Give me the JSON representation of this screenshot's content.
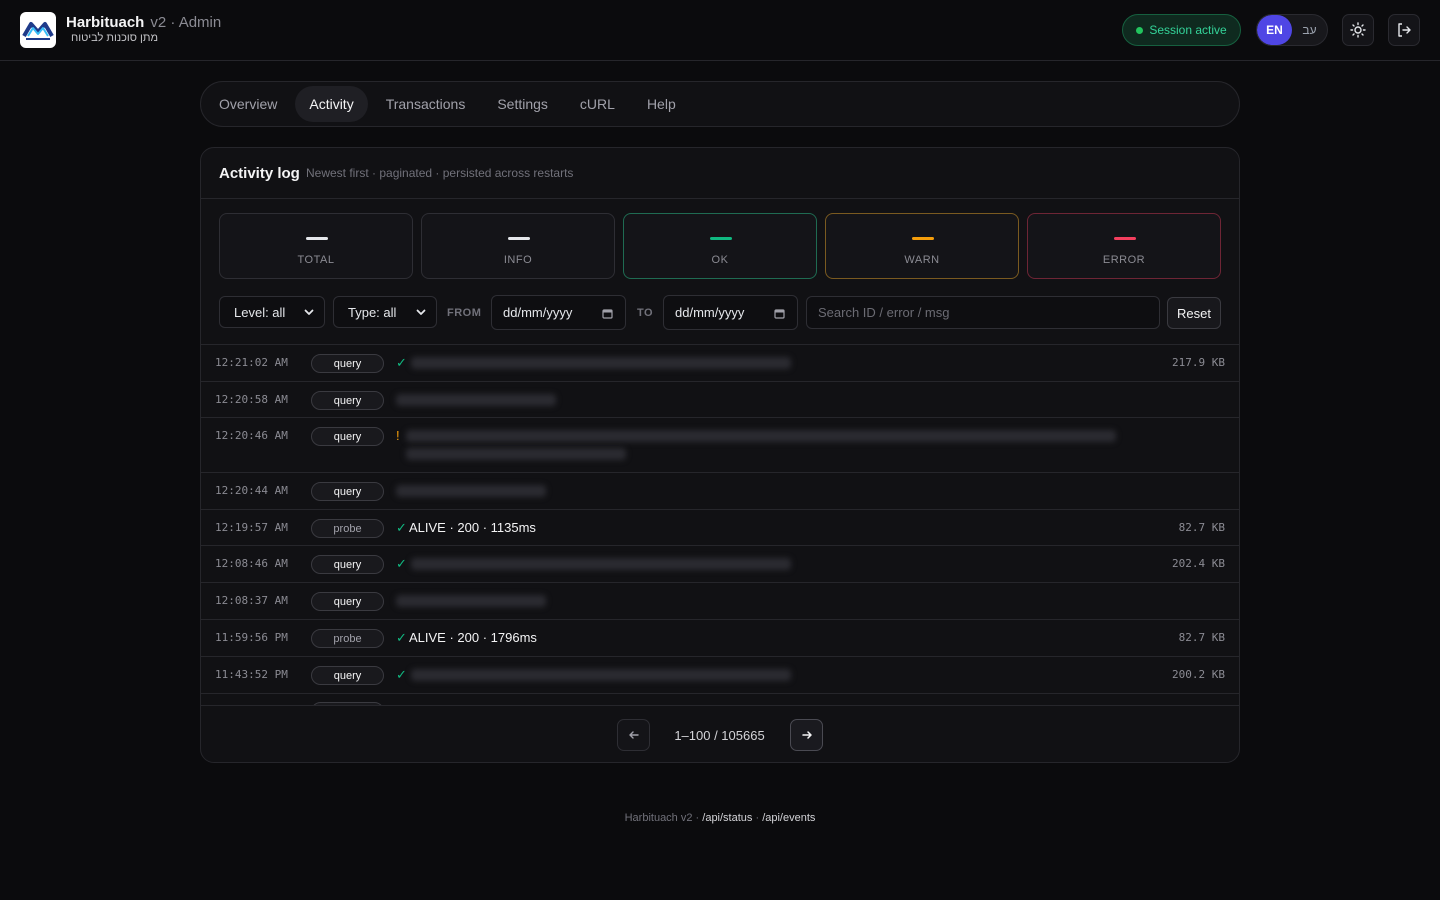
{
  "header": {
    "app_name": "Harbituach",
    "version": "v2 · Admin",
    "subtitle": "מתן סוכנות לביטוח",
    "session_label": "Session active",
    "lang_en": "EN",
    "lang_he": "עב",
    "icons": [
      "sun-icon",
      "logout-icon"
    ]
  },
  "tabs": [
    {
      "label": "Overview",
      "active": false
    },
    {
      "label": "Activity",
      "active": true
    },
    {
      "label": "Transactions",
      "active": false
    },
    {
      "label": "Settings",
      "active": false
    },
    {
      "label": "cURL",
      "active": false
    },
    {
      "label": "Help",
      "active": false
    }
  ],
  "card": {
    "title": "Activity log",
    "subtitle": "Newest first · paginated · persisted across restarts"
  },
  "stats": [
    {
      "label": "TOTAL",
      "value": "—",
      "color": "#e5e7eb",
      "border": "#2e2e34"
    },
    {
      "label": "INFO",
      "value": "—",
      "color": "#e5e7eb",
      "border": "#2e2e34"
    },
    {
      "label": "OK",
      "value": "—",
      "color": "#10b981",
      "border": "#1f6b52"
    },
    {
      "label": "WARN",
      "value": "—",
      "color": "#f59e0b",
      "border": "#7a5a20"
    },
    {
      "label": "ERROR",
      "value": "—",
      "color": "#f43f5e",
      "border": "#6e2535"
    }
  ],
  "filters": {
    "level": "Level: all",
    "type": "Type: all",
    "from_label": "FROM",
    "to_label": "TO",
    "from_value": "dd/mm/yyyy",
    "to_value": "dd/mm/yyyy",
    "search_placeholder": "Search ID / error / msg",
    "reset_label": "Reset"
  },
  "log_rows": [
    {
      "time": "12:21:02 AM",
      "type": "query",
      "status": "ok",
      "message": "",
      "size": "217.9 KB"
    },
    {
      "time": "12:20:58 AM",
      "type": "query",
      "status": "",
      "message": "",
      "size": ""
    },
    {
      "time": "12:20:46 AM",
      "type": "query",
      "status": "warn",
      "message": "",
      "size": ""
    },
    {
      "time": "12:20:44 AM",
      "type": "query",
      "status": "",
      "message": "",
      "size": ""
    },
    {
      "time": "12:19:57 AM",
      "type": "probe",
      "status": "ok",
      "message": "ALIVE · 200 · 1135ms",
      "size": "82.7 KB"
    },
    {
      "time": "12:08:46 AM",
      "type": "query",
      "status": "ok",
      "message": "",
      "size": "202.4 KB"
    },
    {
      "time": "12:08:37 AM",
      "type": "query",
      "status": "",
      "message": "",
      "size": ""
    },
    {
      "time": "11:59:56 PM",
      "type": "probe",
      "status": "ok",
      "message": "ALIVE · 200 · 1796ms",
      "size": "82.7 KB"
    },
    {
      "time": "11:43:52 PM",
      "type": "query",
      "status": "ok",
      "message": "",
      "size": "200.2 KB"
    }
  ],
  "pagination": {
    "info": "1–100 / 105665"
  },
  "footer": {
    "prefix": "Harbituach v2 · ",
    "link1": "/api/status",
    "sep": " · ",
    "link2": "/api/events"
  },
  "colors": {
    "accent": "#4f46e5",
    "ok": "#10b981",
    "warn": "#f59e0b",
    "error": "#f43f5e"
  }
}
